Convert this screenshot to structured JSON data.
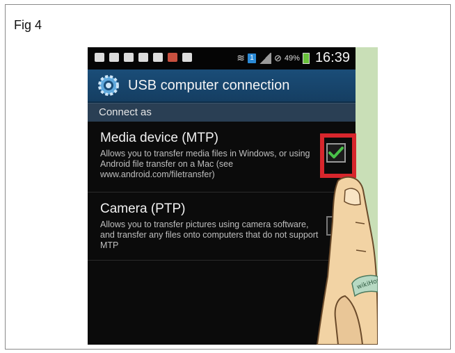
{
  "figure": {
    "label": "Fig 4"
  },
  "statusbar": {
    "battery_percent": "49%",
    "sim_slot": "1",
    "time": "16:39"
  },
  "header": {
    "title": "USB computer connection"
  },
  "section": {
    "label": "Connect as"
  },
  "options": [
    {
      "title": "Media device (MTP)",
      "description": "Allows you to transfer media files in Windows, or using Android file transfer on a Mac (see www.android.com/filetransfer)",
      "checked": true
    },
    {
      "title": "Camera (PTP)",
      "description": "Allows you to transfer pictures using camera software, and transfer any files onto computers that do not support MTP",
      "checked": false
    }
  ],
  "watermark": "wikiHow",
  "colors": {
    "highlight": "#d7262c",
    "check": "#49c149",
    "title_bar": "#1a4d78",
    "section_bar": "#2a3f54"
  }
}
